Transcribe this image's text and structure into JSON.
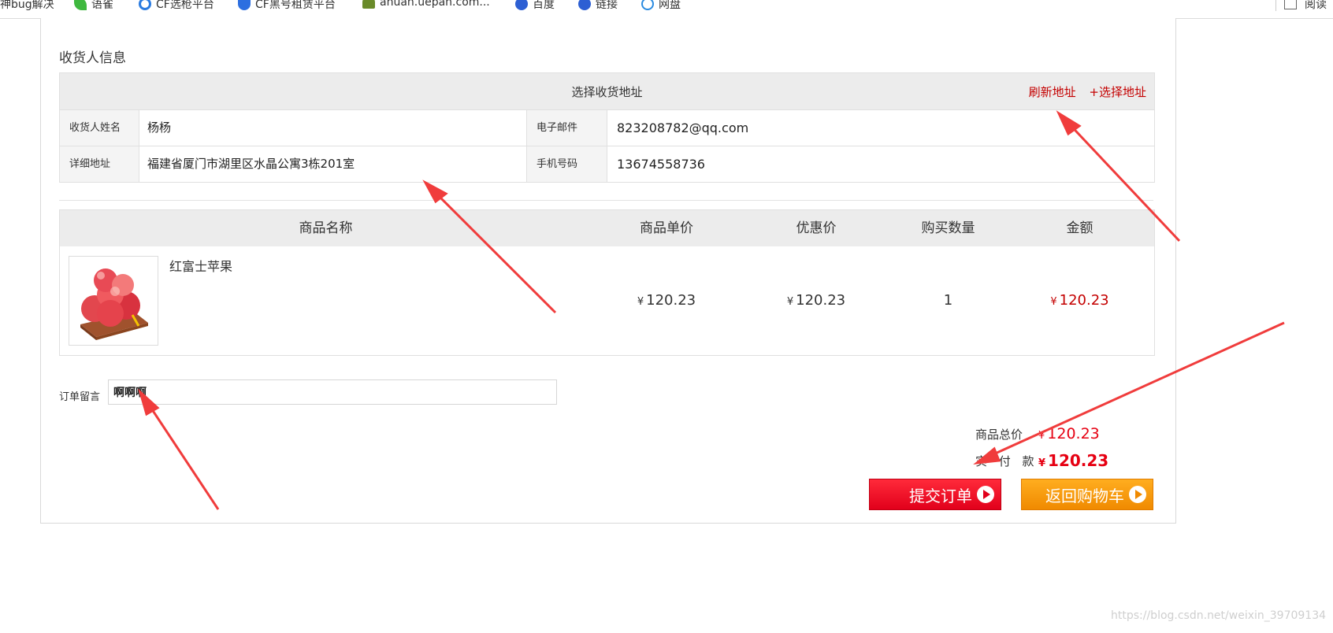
{
  "bookmarks": [
    {
      "label": "神bug解决",
      "icon": "leaf-icon"
    },
    {
      "label": "语雀",
      "icon": "leaf-icon"
    },
    {
      "label": "CF选枪平台",
      "icon": "s-icon"
    },
    {
      "label": "CF黑号租赁平台",
      "icon": "shield-icon"
    },
    {
      "label": "anuan.uepan.com...",
      "icon": "tree-icon"
    },
    {
      "label": "百度",
      "icon": "paw-icon"
    },
    {
      "label": "链接",
      "icon": "paw-icon"
    },
    {
      "label": "网盘",
      "icon": "cloud-icon"
    }
  ],
  "bookmarks_right": "阅读",
  "section_title": "收货人信息",
  "address": {
    "header_title": "选择收货地址",
    "refresh_link": "刷新地址",
    "select_link": "+选择地址",
    "name_label": "收货人姓名",
    "name_value": "杨杨",
    "email_label": "电子邮件",
    "email_value": "823208782@qq.com",
    "detail_label": "详细地址",
    "detail_value": "福建省厦门市湖里区水晶公寓3栋201室",
    "phone_label": "手机号码",
    "phone_value": "13674558736"
  },
  "goods": {
    "headers": [
      "商品名称",
      "商品单价",
      "优惠价",
      "购买数量",
      "金额"
    ],
    "items": [
      {
        "name": "红富士苹果",
        "currency": "¥",
        "price": "120.23",
        "discount_price": "120.23",
        "quantity": "1",
        "amount": "120.23"
      }
    ]
  },
  "remark": {
    "label": "订单留言",
    "value": "啊啊啊"
  },
  "summary": {
    "total_label": "商品总价",
    "total_value": "120.23",
    "paid_label": "实 付 款",
    "paid_value": "120.23",
    "currency": "¥"
  },
  "buttons": {
    "submit": "提交订单",
    "back": "返回购物车"
  },
  "colors": {
    "accent_red": "#e60012",
    "link_red": "#c40000",
    "submit_bg": "#e1001b",
    "back_bg": "#f08a00",
    "annotation_arrow": "#f03c3c"
  },
  "watermark": "https://blog.csdn.net/weixin_39709134"
}
